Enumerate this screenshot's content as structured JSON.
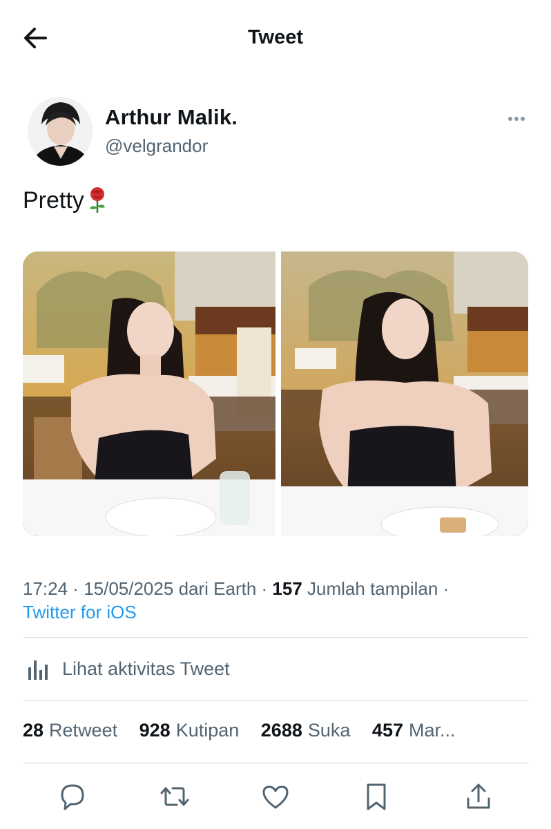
{
  "header": {
    "title": "Tweet",
    "back_icon": "arrow-left-icon"
  },
  "author": {
    "name": "Arthur Malik.",
    "handle": "@velgrandor",
    "avatar": "avatar",
    "more_icon": "more-horizontal-icon"
  },
  "tweet": {
    "text": "Pretty",
    "emoji_icon": "rose-icon"
  },
  "media": {
    "count": 2,
    "photos": [
      "photo-1",
      "photo-2"
    ]
  },
  "meta": {
    "time": "17:24",
    "date": "15/05/2025",
    "location_label": "dari Earth",
    "views": "157",
    "views_label": "Jumlah tampilan",
    "source": "Twitter for iOS"
  },
  "activity": {
    "label": "Lihat aktivitas Tweet",
    "icon": "analytics-icon"
  },
  "stats": {
    "retweets": {
      "count": "28",
      "label": "Retweet"
    },
    "quotes": {
      "count": "928",
      "label": "Kutipan"
    },
    "likes": {
      "count": "2688",
      "label": "Suka"
    },
    "bookmarks": {
      "count": "457",
      "label": "Mar..."
    }
  },
  "actions": [
    "reply-icon",
    "retweet-icon",
    "like-icon",
    "bookmark-icon",
    "share-icon"
  ],
  "colors": {
    "link": "#1d9bf0",
    "secondary": "#536471",
    "text": "#0f1419",
    "divider": "#cfd9de"
  }
}
